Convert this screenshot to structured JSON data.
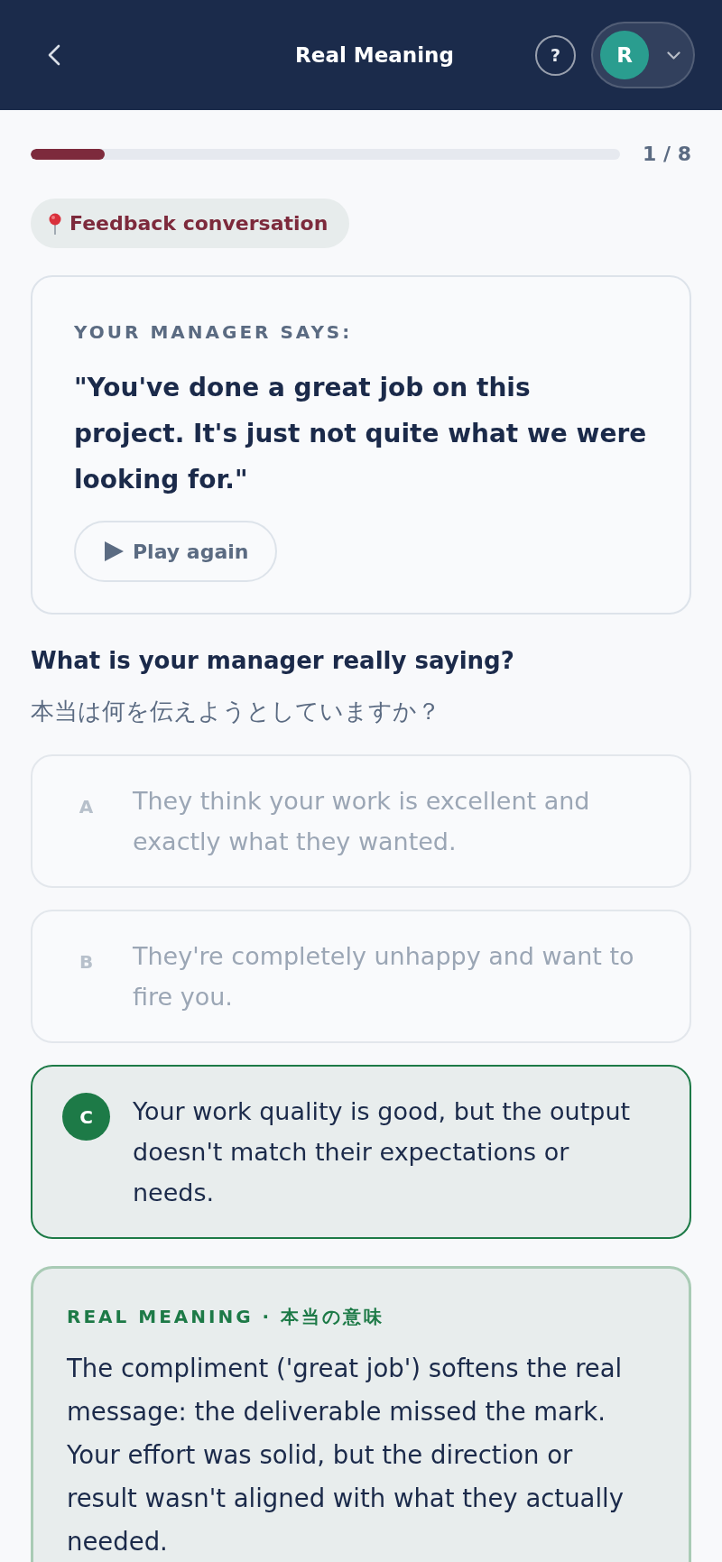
{
  "header": {
    "title": "Real Meaning",
    "help_label": "?",
    "avatar_initial": "R"
  },
  "progress": {
    "level": 0.125,
    "counter": "1 / 8"
  },
  "scenario_tag": {
    "label": "Feedback conversation"
  },
  "quote_card": {
    "label": "YOUR MANAGER SAYS:",
    "quote": "\"You've done a great job on this project. It's just not quite what we were looking for.\"",
    "play_button": "Play again"
  },
  "question": {
    "title": "What is your manager really saying?",
    "subtitle": "本当は何を伝えようとしていますか？"
  },
  "options": [
    {
      "letter": "A",
      "text": "They think your work is excellent and exactly what they wanted.",
      "selected": false
    },
    {
      "letter": "B",
      "text": "They're completely unhappy and want to fire you.",
      "selected": false
    },
    {
      "letter": "C",
      "text": "Your work quality is good, but the output doesn't match their expectations or needs.",
      "selected": true
    }
  ],
  "explanation": {
    "label": "REAL MEANING · 本当の意味",
    "text": "The compliment ('great job') softens the real message: the deliverable missed the mark. Your effort was solid, but the direction or result wasn't aligned with what they actually needed."
  }
}
